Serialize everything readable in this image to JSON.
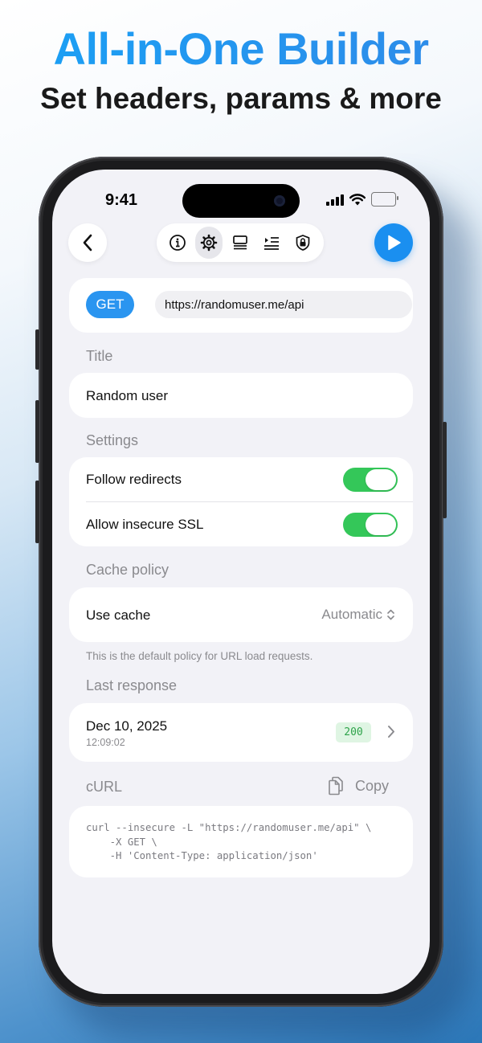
{
  "promo": {
    "headline": "All-in-One Builder",
    "subheadline": "Set headers, params & more"
  },
  "status_bar": {
    "time": "9:41"
  },
  "toolbar": {
    "items": [
      "info-icon",
      "gear-icon",
      "layout-icon",
      "list-indent-icon",
      "lock-shield-icon"
    ],
    "active": "gear-icon"
  },
  "colors": {
    "accent": "#1a8ff0",
    "toggle_on": "#34c759",
    "status_ok_bg": "#dff5e3",
    "status_ok_text": "#2ea34a"
  },
  "request": {
    "method": "GET",
    "url": "https://randomuser.me/api"
  },
  "title_section": {
    "label": "Title",
    "value": "Random user"
  },
  "settings_section": {
    "label": "Settings",
    "follow_redirects": {
      "label": "Follow redirects",
      "on": true
    },
    "allow_insecure_ssl": {
      "label": "Allow insecure SSL",
      "on": true
    }
  },
  "cache_section": {
    "label": "Cache policy",
    "row_label": "Use cache",
    "value": "Automatic",
    "footnote": "This is the default policy for URL load requests."
  },
  "last_response": {
    "label": "Last response",
    "date": "Dec 10, 2025",
    "time": "12:09:02",
    "status": "200"
  },
  "curl": {
    "label": "cURL",
    "copy_label": "Copy",
    "command": "curl --insecure -L \"https://randomuser.me/api\" \\\n    -X GET \\\n    -H 'Content-Type: application/json'"
  }
}
